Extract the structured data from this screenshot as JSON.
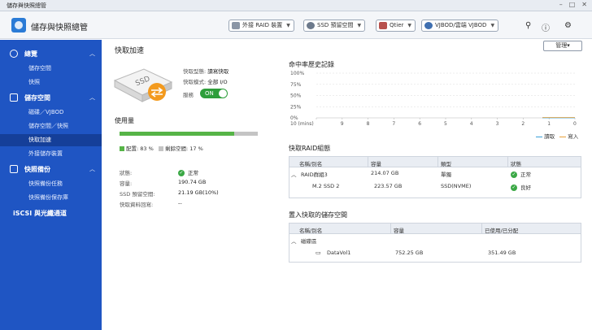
{
  "window": {
    "title": "儲存與快照總管"
  },
  "header": {
    "app_title": "儲存與快照總管",
    "buttons": [
      {
        "label": "外接 RAID 裝置"
      },
      {
        "label": "SSD 預留空間"
      },
      {
        "label": "Qtier"
      },
      {
        "label": "VJBOD/雲端 VJBOD"
      }
    ]
  },
  "sidebar": {
    "sections": [
      {
        "label": "總覽",
        "items": [
          "儲存空間",
          "快照"
        ]
      },
      {
        "label": "儲存空間",
        "items": [
          "磁碟／VJBOD",
          "儲存空間／快照",
          "快取加速",
          "外接儲存裝置"
        ]
      },
      {
        "label": "快照備份",
        "items": [
          "快照備份任務",
          "快照備份保存庫"
        ]
      },
      {
        "label": "iSCSI 與光纖通道",
        "items": []
      }
    ]
  },
  "main": {
    "title": "快取加速",
    "manage_label": "管理▾",
    "cache_info": {
      "type_label": "快取型態:",
      "type_value": "讀寫快取",
      "mode_label": "快取模式:",
      "mode_value": "全部 I/O",
      "service_label": "服務",
      "toggle_label": "ON",
      "toggle_on": true,
      "ssd_text": "SSD"
    },
    "usage": {
      "title": "使用量",
      "used_percent": 83,
      "free_percent": 17,
      "used_label": "配置: 83 %",
      "free_label": "剩餘空間: 17 %",
      "used_color": "#56b447",
      "free_color": "#c4c4c4"
    },
    "details": [
      {
        "label": "狀態:",
        "value": "正常",
        "ok": true
      },
      {
        "label": "容量:",
        "value": "190.74 GB"
      },
      {
        "label": "SSD 預留空間:",
        "value": "21.19 GB(10%)"
      },
      {
        "label": "快取資料回寫:",
        "value": "--"
      }
    ],
    "hit_history": {
      "title": "命中率歷史記錄",
      "y_ticks": [
        "100%",
        "75%",
        "50%",
        "25%",
        "0%"
      ],
      "x_ticks": [
        "10 (mins)",
        "9",
        "8",
        "7",
        "6",
        "5",
        "4",
        "3",
        "2",
        "1",
        "0"
      ],
      "legend_read": "讀取",
      "legend_write": "寫入",
      "read_color": "#3aa0d8",
      "write_color": "#e8a13a"
    },
    "raid_group": {
      "title": "快取RAID組態",
      "columns": [
        "名稱/別名",
        "容量",
        "類型",
        "狀態"
      ],
      "rows": [
        {
          "name": "RAID群組3",
          "capacity": "214.07 GB",
          "type": "單獨",
          "status": "正常"
        },
        {
          "name": "M.2 SSD 2",
          "capacity": "223.57 GB",
          "type": "SSD(NVME)",
          "status": "良好"
        }
      ]
    },
    "cached_spaces": {
      "title": "置入快取的儲存空間",
      "columns": [
        "名稱/別名",
        "容量",
        "已使用/已分配"
      ],
      "group": "磁碟區",
      "rows": [
        {
          "name": "DataVol1",
          "capacity": "752.25 GB",
          "used": "351.49 GB"
        }
      ]
    }
  }
}
